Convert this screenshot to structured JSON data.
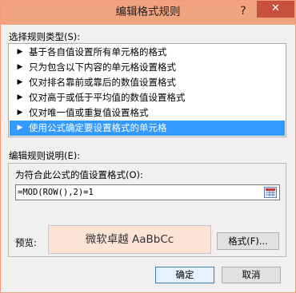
{
  "window": {
    "title": "编辑格式规则",
    "help": "?",
    "close": "✕"
  },
  "rule_types": {
    "label": "选择规则类型(S):",
    "items": [
      {
        "label": "基于各自值设置所有单元格的格式",
        "selected": false
      },
      {
        "label": "只为包含以下内容的单元格设置格式",
        "selected": false
      },
      {
        "label": "仅对排名靠前或靠后的数值设置格式",
        "selected": false
      },
      {
        "label": "仅对高于或低于平均值的数值设置格式",
        "selected": false
      },
      {
        "label": "仅对唯一值或重复值设置格式",
        "selected": false
      },
      {
        "label": "使用公式确定要设置格式的单元格",
        "selected": true
      }
    ],
    "arrow": "▶"
  },
  "description": {
    "label": "编辑规则说明(E):",
    "formula_label": "为符合此公式的值设置格式(O):",
    "formula_value": "=MOD(ROW(),2)=1",
    "ref_icon": "range-select-icon",
    "preview_label": "预览:",
    "preview_text": "微软卓越  AaBbCc",
    "preview_fill": "#fbe4d5",
    "format_button": "格式(F)..."
  },
  "buttons": {
    "ok": "确定",
    "cancel": "取消"
  },
  "colors": {
    "titlebar": "#f0a37f",
    "close": "#c7503f",
    "selection": "#3399ff"
  }
}
